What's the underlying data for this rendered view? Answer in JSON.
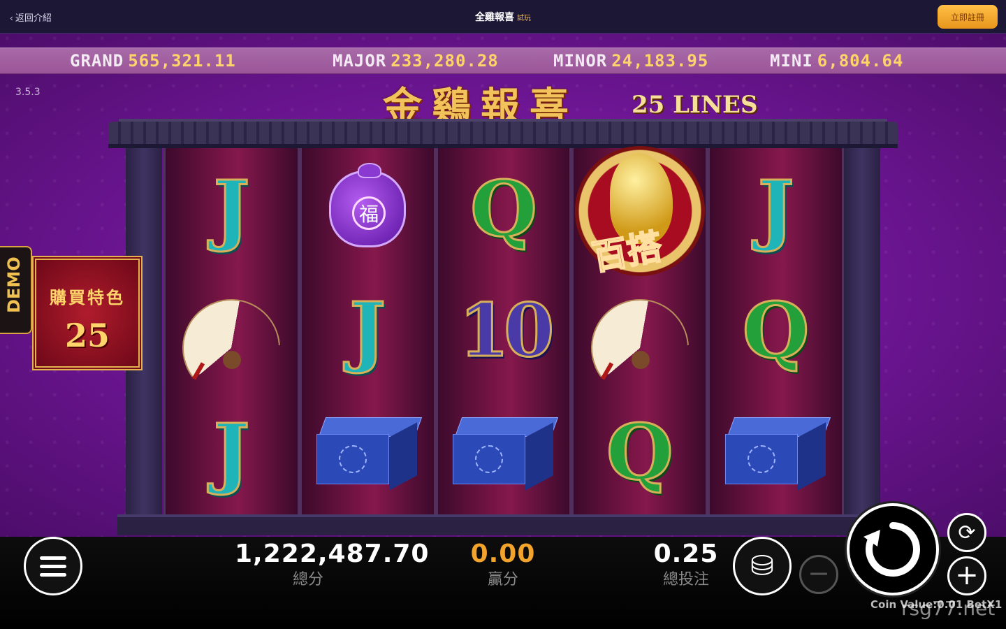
{
  "topbar": {
    "back_label": "返回介紹",
    "title": "全雞報喜",
    "title_tag": "試玩",
    "register_label": "立即註冊"
  },
  "jackpots": [
    {
      "label": "GRAND",
      "value": "565,321.11"
    },
    {
      "label": "MAJOR",
      "value": "233,280.28"
    },
    {
      "label": "MINOR",
      "value": "24,183.95"
    },
    {
      "label": "MINI",
      "value": "6,804.64"
    }
  ],
  "version": "3.5.3",
  "logo": {
    "chinese": "金鷄報喜",
    "lines": "25 LINES"
  },
  "demo_label": "DEMO",
  "buy_feature": {
    "title": "購買特色",
    "cost": "25"
  },
  "reels": [
    [
      "J",
      "fan",
      "J"
    ],
    [
      "bag",
      "J",
      "box"
    ],
    [
      "Q",
      "10",
      "box"
    ],
    [
      "wild",
      "fan",
      "Q"
    ],
    [
      "J",
      "Q",
      "box"
    ]
  ],
  "symbols": {
    "bag_char": "福",
    "wild_text": "百搭"
  },
  "stats": {
    "balance_value": "1,222,487.70",
    "balance_label": "總分",
    "win_value": "0.00",
    "win_label": "贏分",
    "bet_value": "0.25",
    "bet_label": "總投注"
  },
  "coin_value_text": "Coin Value:0.01 BetX1",
  "watermark": "rsg77.net",
  "icons": [
    "chevron-left-icon",
    "menu-icon",
    "coins-icon",
    "minus-icon",
    "spin-icon",
    "autoplay-icon",
    "plus-icon"
  ],
  "colors": {
    "accent": "#f2a32c",
    "jackpot_value": "#ffd36b",
    "background": "#6b1591"
  }
}
